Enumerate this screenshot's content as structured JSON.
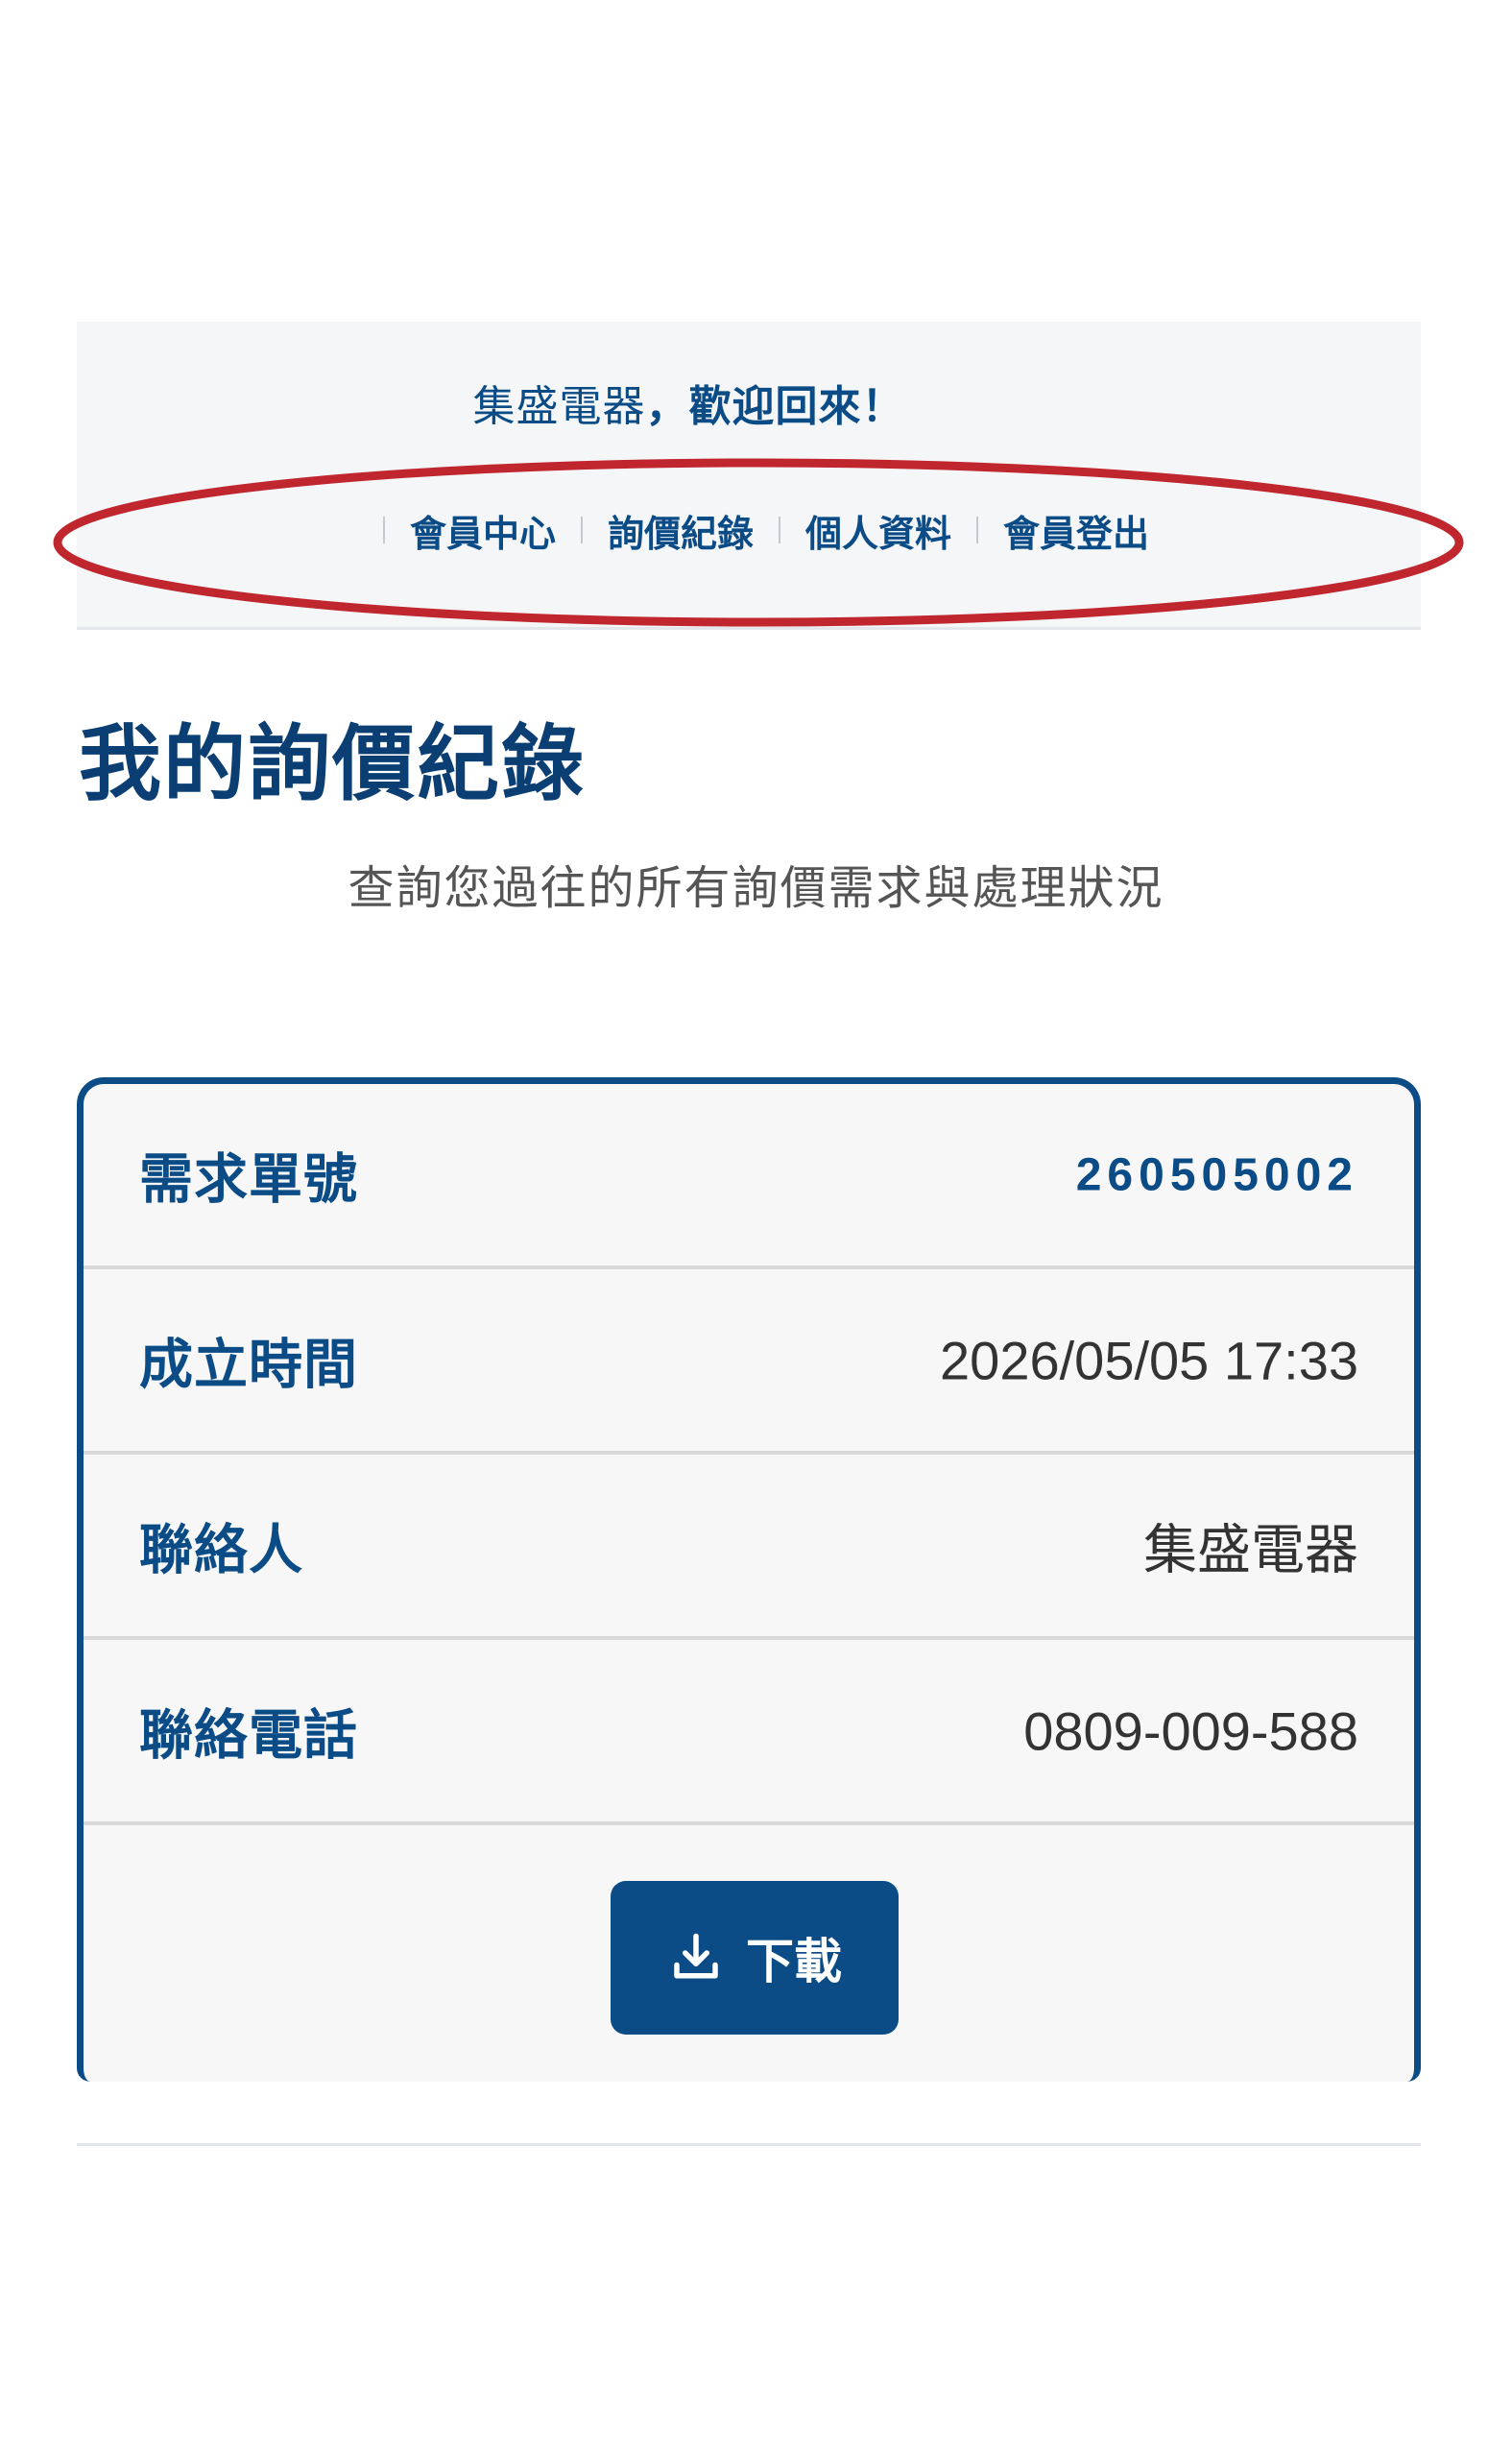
{
  "header": {
    "greeting_name": "集盛電器",
    "greeting_text": "，歡迎回來！",
    "nav": [
      {
        "label": "會員中心"
      },
      {
        "label": "詢價紀錄"
      },
      {
        "label": "個人資料"
      },
      {
        "label": "會員登出"
      }
    ]
  },
  "page": {
    "title": "我的詢價紀錄",
    "subtitle": "查詢您過往的所有詢價需求與處理狀況"
  },
  "record": {
    "rows": [
      {
        "label": "需求單號",
        "value": "260505002"
      },
      {
        "label": "成立時間",
        "value": "2026/05/05 17:33"
      },
      {
        "label": "聯絡人",
        "value": "集盛電器"
      },
      {
        "label": "聯絡電話",
        "value": "0809-009-588"
      }
    ],
    "download_label": "下載"
  },
  "colors": {
    "brand": "#0b4b86",
    "highlight": "#c0262e"
  },
  "icons": {
    "download": "download-icon"
  }
}
